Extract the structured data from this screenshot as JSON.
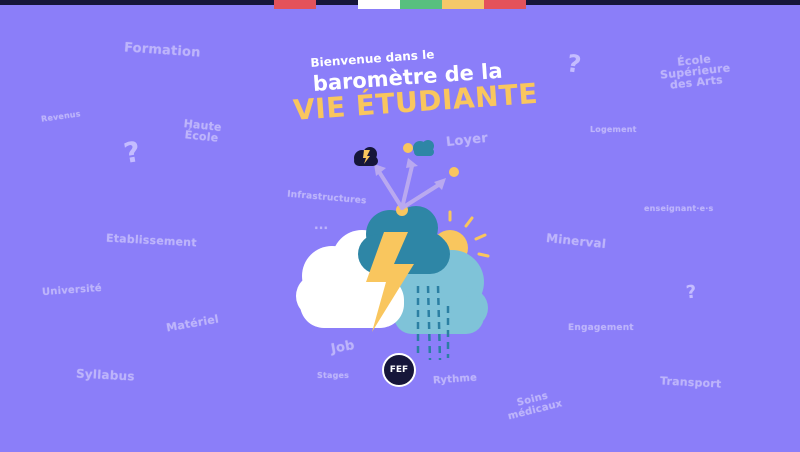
{
  "header": {
    "line1": "Bienvenue dans le",
    "line2": "baromètre de la",
    "line3": "VIE ÉTUDIANTE"
  },
  "topbar": {
    "segment_colors": [
      "#e4525b",
      "#ffffff",
      "#58c07f",
      "#f5c869",
      "#e4525b"
    ]
  },
  "words": {
    "formation": "Formation",
    "revenus": "Revenus",
    "haute_ecole": "Haute\nÉcole",
    "etablissement": "Etablissement",
    "universite": "Université",
    "materiel": "Matériel",
    "syllabus": "Syllabus",
    "infrastructures": "Infrastructures",
    "ellipsis": "...",
    "job": "Job",
    "stages": "Stages",
    "rythme": "Rythme",
    "soins": "Soins\nmédicaux",
    "loyer": "Loyer",
    "logement": "Logement",
    "ecole_sup": "École\nSupérieure\ndes Arts",
    "enseignant": "enseignant·e·s",
    "minerval": "Minerval",
    "engagement": "Engagement",
    "transport": "Transport",
    "qmark": "?"
  },
  "logo": {
    "text": "FEF"
  },
  "icons": [
    "storm-cloud-icon",
    "sun-cloud-icon",
    "sun-icon",
    "lightning-cloud-icon",
    "question-mark-icon"
  ]
}
